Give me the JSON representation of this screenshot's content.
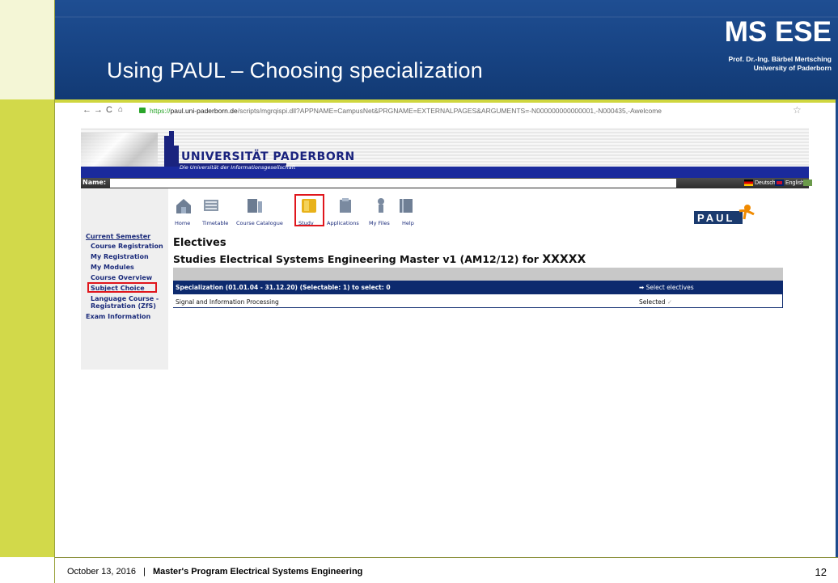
{
  "slide": {
    "title": "Using PAUL – Choosing specialization",
    "brand": "MS ESE",
    "professor": "Prof. Dr.-Ing. Bärbel Mertsching",
    "university": "University of Paderborn",
    "footer_date": "October 13, 2016",
    "footer_separator": "|",
    "footer_program": "Master's Program Electrical Systems Engineering",
    "page_number": "12",
    "colors": {
      "header_blue": "#174383",
      "accent_green": "#d2d94a",
      "highlight_red": "#e0161c"
    }
  },
  "browser": {
    "url_prefix": "https://",
    "url_host": "paul.uni-paderborn.de",
    "url_path": "/scripts/mgrqispi.dll?APPNAME=CampusNet&PRGNAME=EXTERNALPAGES&ARGUMENTS=-N000000000000001,-N000435,-Awelcome",
    "icons": [
      "back-icon",
      "forward-icon",
      "reload-icon",
      "home-icon",
      "lock-icon",
      "star-icon"
    ]
  },
  "portal": {
    "university_name": "UNIVERSITÄT PADERBORN",
    "tagline": "Die Universität der Informationsgesellschaft",
    "name_label": "Name:",
    "languages": [
      "Deutsch",
      "English"
    ],
    "toolbar": [
      {
        "label": "Home",
        "icon": "home-icon"
      },
      {
        "label": "Timetable",
        "icon": "timetable-icon"
      },
      {
        "label": "Course Catalogue",
        "icon": "course-catalogue-icon"
      },
      {
        "label": "Study",
        "icon": "study-icon"
      },
      {
        "label": "Applications",
        "icon": "applications-icon"
      },
      {
        "label": "My Files",
        "icon": "my-files-icon"
      },
      {
        "label": "Help",
        "icon": "help-icon"
      }
    ],
    "paul_logo": "PAUL",
    "nav": {
      "current_semester": "Current Semester",
      "items": [
        "Course Registration",
        "My Registration",
        "My Modules",
        "Course Overview",
        "Subject Choice",
        "Language Course -",
        "Registration (ZfS)"
      ],
      "exam_information": "Exam Information"
    },
    "content": {
      "heading": "Electives",
      "program": "Studies Electrical Systems Engineering Master v1 (AM12/12) for",
      "program_for": "XXXXX",
      "specialization_row": "Specialization (01.01.04 - 31.12.20) (Selectable: 1) to select: 0",
      "select_electives": "Select electives",
      "course": "Signal and Information Processing",
      "status": "Selected"
    }
  }
}
